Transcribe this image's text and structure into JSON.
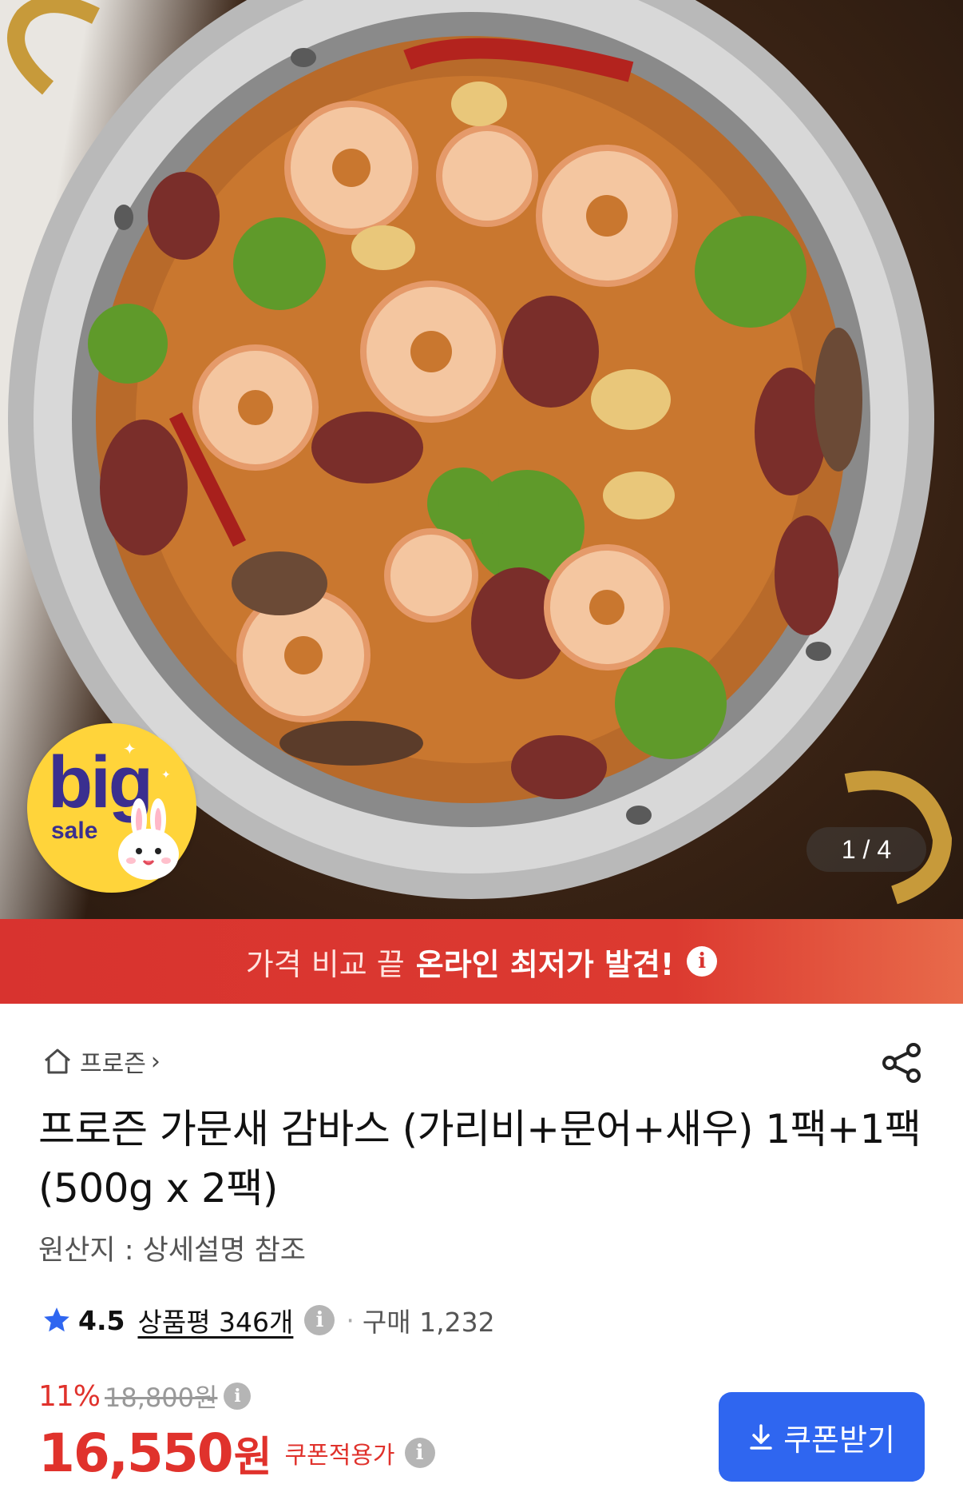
{
  "product_image": {
    "badge": {
      "big": "big",
      "sale": "sale"
    },
    "pager": "1 / 4"
  },
  "banner": {
    "light_text": "가격 비교 끝",
    "bold_text": "온라인 최저가 발견!",
    "info_icon": "info-icon"
  },
  "breadcrumb": {
    "home_icon": "home-icon",
    "category": "프로즌"
  },
  "share_icon": "share-icon",
  "title": "프로즌 가문새 감바스 (가리비+문어+새우) 1팩+1팩 (500g x 2팩)",
  "origin": "원산지 : 상세설명 참조",
  "rating": {
    "score": "4.5",
    "reviews": "상품평 346개",
    "separator": "·",
    "purchases": "구매 1,232"
  },
  "pricing": {
    "discount_percent": "11%",
    "original_price": "18,800원",
    "sale_price": "16,550",
    "currency": "원",
    "coupon_price_label": "쿠폰적용가"
  },
  "coupon_button": {
    "label": "쿠폰받기",
    "icon": "download-icon"
  },
  "colors": {
    "banner_red": "#d8332f",
    "price_red": "#e0322c",
    "coupon_blue": "#2f66f0",
    "star_blue": "#2f66f0"
  }
}
